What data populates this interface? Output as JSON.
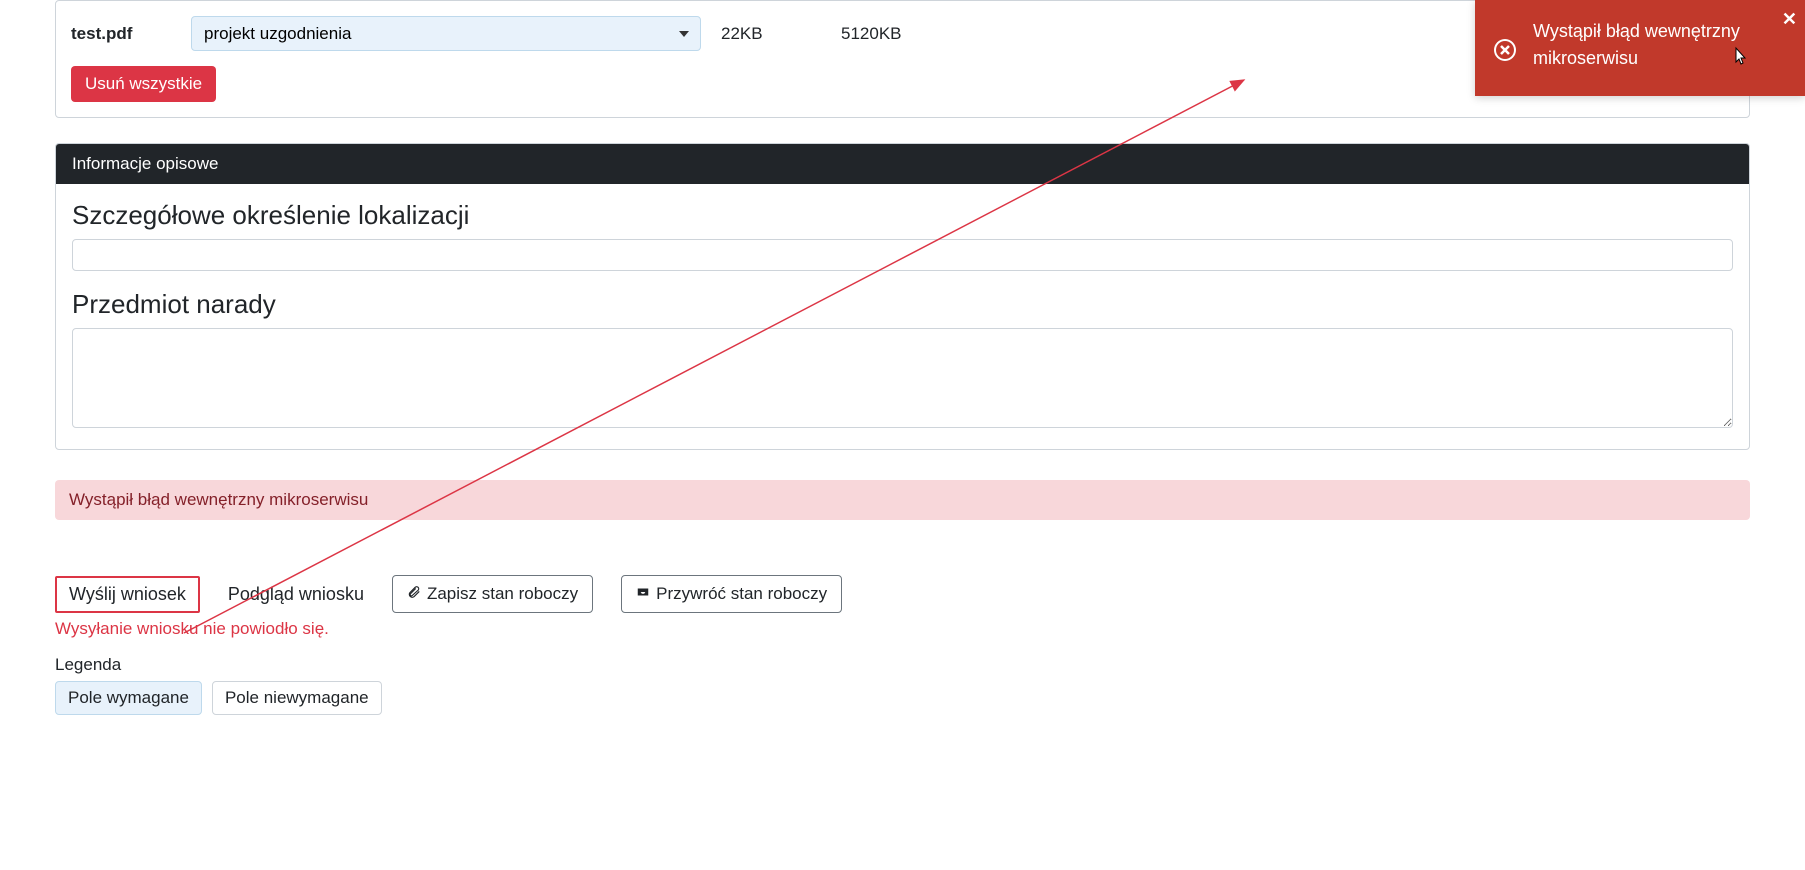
{
  "file": {
    "name": "test.pdf",
    "select_value": "projekt uzgodnienia",
    "size": "22KB",
    "max_size": "5120KB"
  },
  "buttons": {
    "delete_all": "Usuń wszystkie",
    "send": "Wyślij wniosek",
    "preview": "Podgląd wniosku",
    "save_draft": "Zapisz stan roboczy",
    "restore_draft": "Przywróć stan roboczy"
  },
  "panel": {
    "header": "Informacje opisowe",
    "field1_label": "Szczegółowe określenie lokalizacji",
    "field1_value": "",
    "field2_label": "Przedmiot narady",
    "field2_value": ""
  },
  "alerts": {
    "inline_error": "Wystąpił błąd wewnętrzny mikroserwisu",
    "send_fail": "Wysyłanie wniosku nie powiodło się.",
    "toast": "Wystąpił błąd wewnętrzny mikroserwisu"
  },
  "legend": {
    "label": "Legenda",
    "required": "Pole wymagane",
    "not_required": "Pole niewymagane"
  }
}
